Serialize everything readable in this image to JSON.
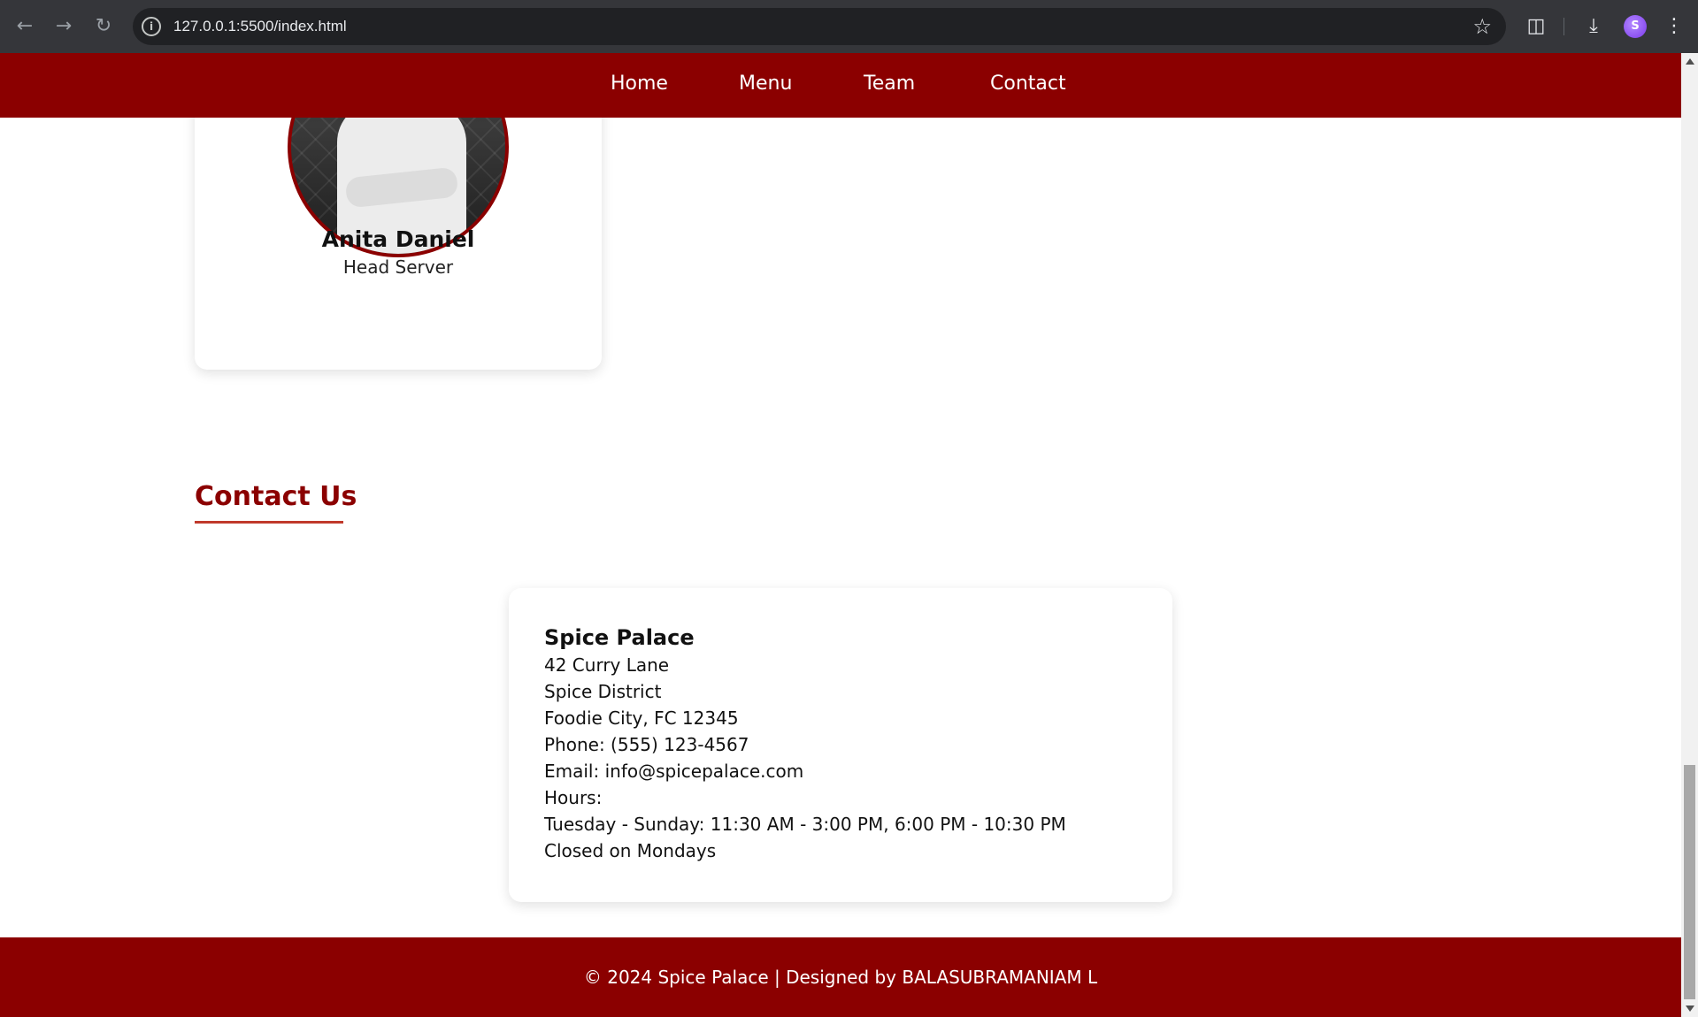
{
  "browser": {
    "url": "127.0.0.1:5500/index.html",
    "avatar_letter": "S",
    "icons": [
      "back-icon",
      "forward-icon",
      "reload-icon",
      "site-info-icon",
      "bookmark-star-icon",
      "extensions-icon",
      "download-icon",
      "profile-avatar",
      "more-menu-icon"
    ]
  },
  "nav": {
    "items": [
      "Home",
      "Menu",
      "Team",
      "Contact"
    ]
  },
  "team": {
    "member": {
      "name": "Anita Daniel",
      "role": "Head Server"
    }
  },
  "contact": {
    "title": "Contact Us",
    "business_name": "Spice Palace",
    "lines": [
      "42 Curry Lane",
      "Spice District",
      "Foodie City, FC 12345",
      "Phone: (555) 123-4567",
      "Email: info@spicepalace.com",
      "Hours:",
      "Tuesday - Sunday: 11:30 AM - 3:00 PM, 6:00 PM - 10:30 PM",
      "Closed on Mondays"
    ]
  },
  "footer": {
    "text": "© 2024 Spice Palace | Designed by BALASUBRAMANIAM L"
  },
  "colors": {
    "brand": "#8b0000",
    "chrome": "#35363a"
  }
}
